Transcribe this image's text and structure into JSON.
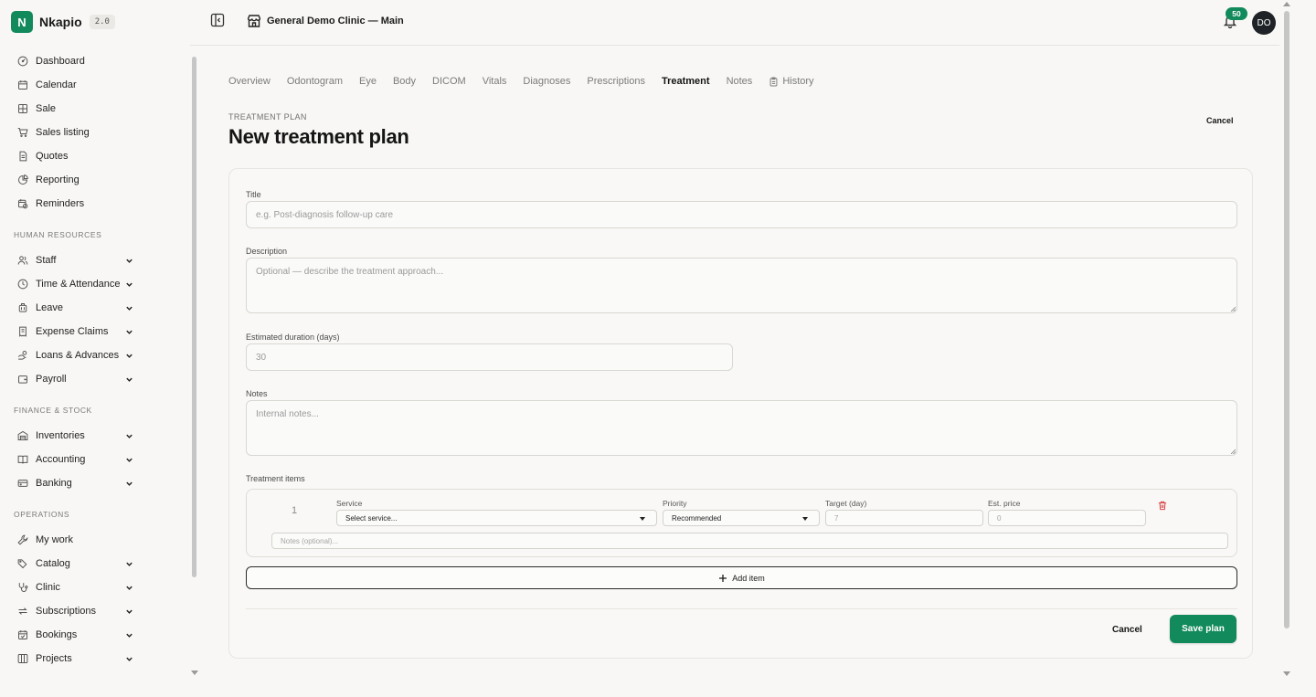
{
  "brand": {
    "initial": "N",
    "name": "Nkapio",
    "version": "2.0"
  },
  "sidebar": {
    "main": [
      {
        "label": "Dashboard",
        "icon": "gauge-icon"
      },
      {
        "label": "Calendar",
        "icon": "calendar-icon"
      },
      {
        "label": "Sale",
        "icon": "grid-icon"
      },
      {
        "label": "Sales listing",
        "icon": "cart-icon"
      },
      {
        "label": "Quotes",
        "icon": "document-icon"
      },
      {
        "label": "Reporting",
        "icon": "pie-chart-icon"
      },
      {
        "label": "Reminders",
        "icon": "calendar-clock-icon"
      }
    ],
    "hr_title": "HUMAN RESOURCES",
    "hr": [
      {
        "label": "Staff",
        "icon": "users-icon"
      },
      {
        "label": "Time & Attendance",
        "icon": "clock-icon"
      },
      {
        "label": "Leave",
        "icon": "luggage-icon"
      },
      {
        "label": "Expense Claims",
        "icon": "receipt-icon"
      },
      {
        "label": "Loans & Advances",
        "icon": "hand-coins-icon"
      },
      {
        "label": "Payroll",
        "icon": "wallet-icon"
      }
    ],
    "finance_title": "FINANCE & STOCK",
    "finance": [
      {
        "label": "Inventories",
        "icon": "warehouse-icon"
      },
      {
        "label": "Accounting",
        "icon": "book-icon"
      },
      {
        "label": "Banking",
        "icon": "bank-card-icon"
      }
    ],
    "ops_title": "OPERATIONS",
    "ops": [
      {
        "label": "My work",
        "icon": "wrench-icon"
      },
      {
        "label": "Catalog",
        "icon": "tags-icon"
      },
      {
        "label": "Clinic",
        "icon": "stethoscope-icon"
      },
      {
        "label": "Subscriptions",
        "icon": "repeat-icon"
      },
      {
        "label": "Bookings",
        "icon": "calendar-check-icon"
      },
      {
        "label": "Projects",
        "icon": "kanban-icon"
      }
    ]
  },
  "topbar": {
    "clinic_name": "General Demo Clinic — Main",
    "notification_count": "50",
    "avatar_initials": "DO"
  },
  "tabs": [
    {
      "label": "Overview"
    },
    {
      "label": "Odontogram"
    },
    {
      "label": "Eye"
    },
    {
      "label": "Body"
    },
    {
      "label": "DICOM"
    },
    {
      "label": "Vitals"
    },
    {
      "label": "Diagnoses"
    },
    {
      "label": "Prescriptions"
    },
    {
      "label": "Treatment",
      "active": true
    },
    {
      "label": "Notes"
    },
    {
      "label": "History",
      "icon": "clipboard-icon"
    }
  ],
  "page": {
    "eyebrow": "TREATMENT PLAN",
    "title": "New treatment plan",
    "cancel_label": "Cancel"
  },
  "form": {
    "title_label": "Title",
    "title_placeholder": "e.g. Post-diagnosis follow-up care",
    "description_label": "Description",
    "description_placeholder": "Optional — describe the treatment approach...",
    "duration_label": "Estimated duration (days)",
    "duration_placeholder": "30",
    "notes_label": "Notes",
    "notes_placeholder": "Internal notes...",
    "items_label": "Treatment items",
    "item": {
      "number": "1",
      "service_label": "Service",
      "service_value": "Select service...",
      "priority_label": "Priority",
      "priority_value": "Recommended",
      "target_label": "Target (day)",
      "target_placeholder": "7",
      "price_label": "Est. price",
      "price_placeholder": "0",
      "notes_placeholder": "Notes (optional)..."
    },
    "add_item_label": "Add item",
    "cancel_label": "Cancel",
    "save_label": "Save plan"
  },
  "colors": {
    "accent": "#128a5c",
    "danger": "#d64545"
  }
}
